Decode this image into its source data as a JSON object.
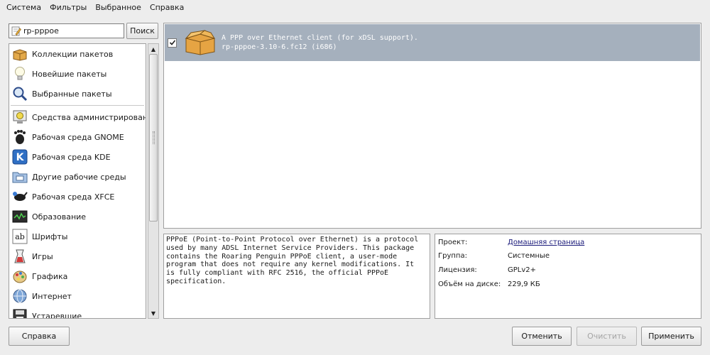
{
  "menubar": {
    "items": [
      "Система",
      "Фильтры",
      "Выбранное",
      "Справка"
    ]
  },
  "search": {
    "value": "rp-pppoe",
    "button_label": "Поиск"
  },
  "groups": {
    "items": [
      {
        "label": "Коллекции пакетов",
        "icon": "box-collection-icon"
      },
      {
        "label": "Новейшие пакеты",
        "icon": "lightbulb-icon"
      },
      {
        "label": "Выбранные пакеты",
        "icon": "magnifier-icon"
      },
      {
        "label": "Средства администрирования",
        "icon": "admin-tools-icon"
      },
      {
        "label": "Рабочая среда GNOME",
        "icon": "gnome-foot-icon"
      },
      {
        "label": "Рабочая среда KDE",
        "icon": "kde-icon"
      },
      {
        "label": "Другие рабочие среды",
        "icon": "desktop-folder-icon"
      },
      {
        "label": "Рабочая среда XFCE",
        "icon": "xfce-mouse-icon"
      },
      {
        "label": "Образование",
        "icon": "education-icon"
      },
      {
        "label": "Шрифты",
        "icon": "fonts-icon"
      },
      {
        "label": "Игры",
        "icon": "games-icon"
      },
      {
        "label": "Графика",
        "icon": "graphics-icon"
      },
      {
        "label": "Интернет",
        "icon": "globe-icon"
      },
      {
        "label": "Устаревшие",
        "icon": "floppy-icon"
      }
    ]
  },
  "packages": [
    {
      "checked": true,
      "summary": "A PPP over Ethernet client (for xDSL support).",
      "name": "rp-pppoe-3.10-6.fc12 (i686)"
    }
  ],
  "description": "PPPoE (Point-to-Point Protocol over Ethernet) is a protocol\nused by many ADSL Internet Service Providers. This package\ncontains the Roaring Penguin PPPoE client, a user-mode\nprogram that does not require any kernel modifications. It\nis fully compliant with RFC 2516, the official PPPoE\nspecification.",
  "details": {
    "project_label": "Проект:",
    "project_value": "Домашняя страница",
    "group_label": "Группа:",
    "group_value": "Системные",
    "license_label": "Лицензия:",
    "license_value": "GPLv2+",
    "size_label": "Объём на диске:",
    "size_value": "229,9 КБ"
  },
  "buttons": {
    "help": "Справка",
    "cancel": "Отменить",
    "clear": "Очистить",
    "apply": "Применить"
  },
  "colors": {
    "selection": "#a5b0bd",
    "background": "#ededed"
  }
}
